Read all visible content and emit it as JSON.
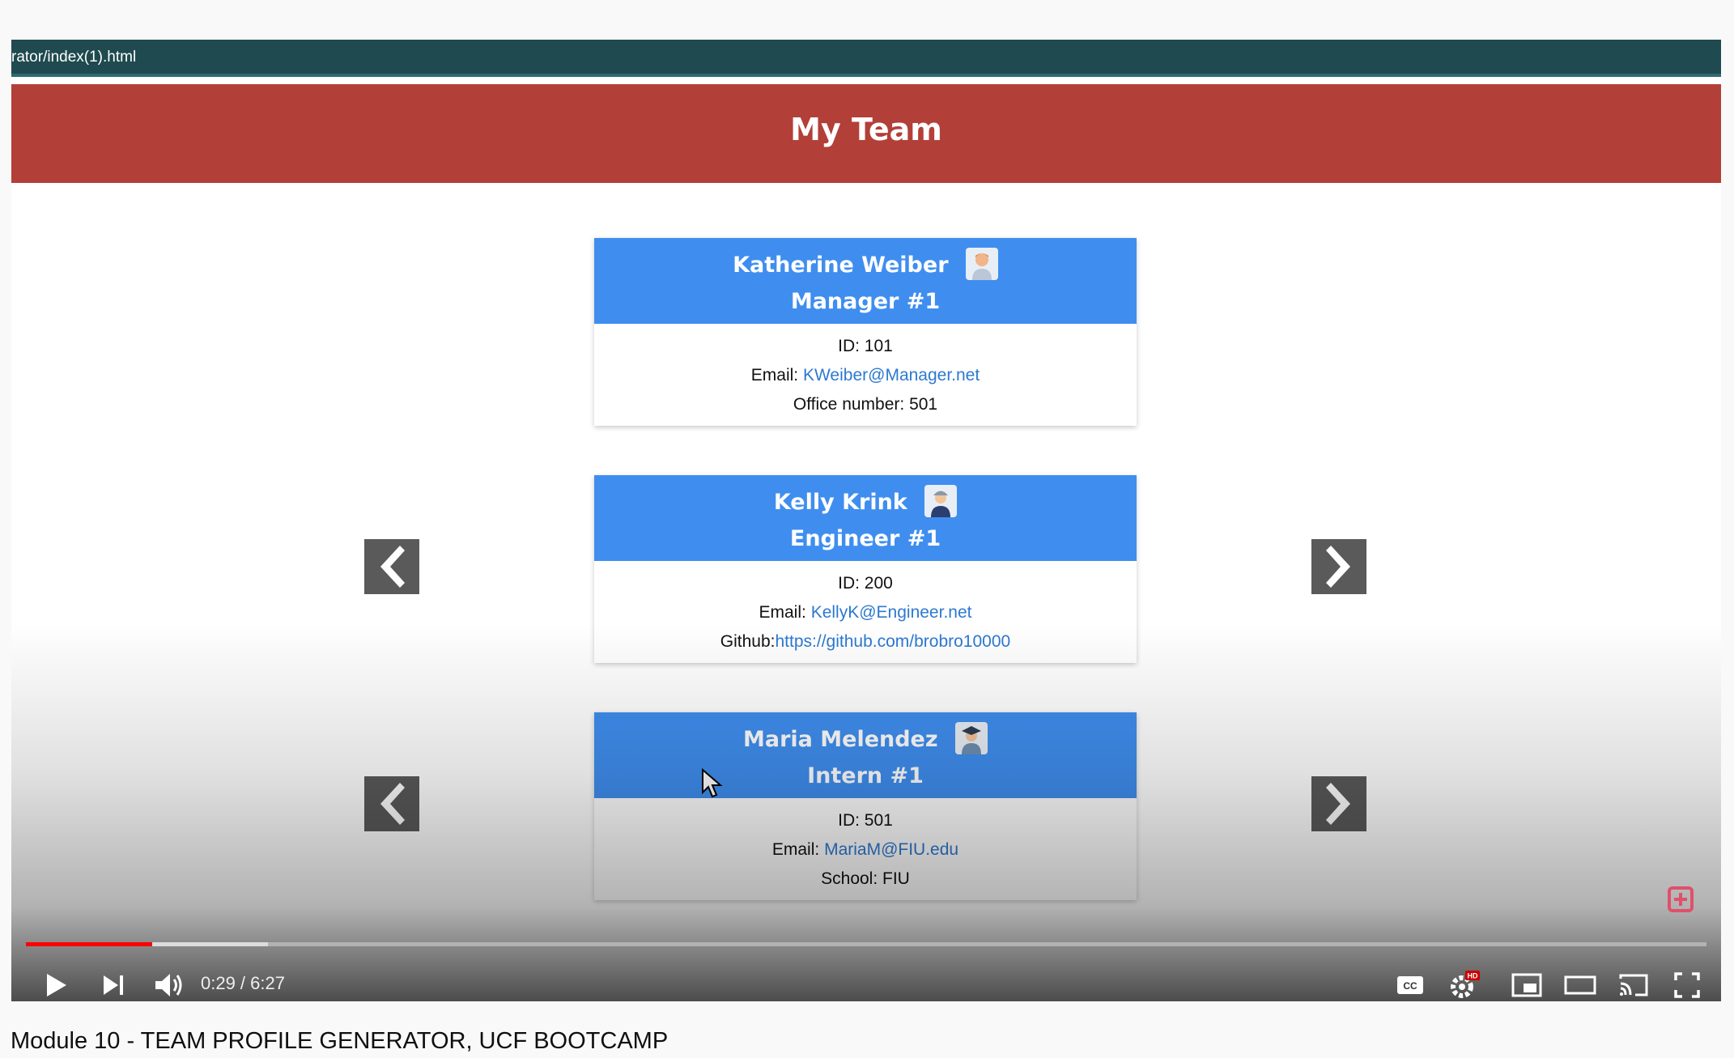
{
  "browser": {
    "url": "rator/index(1).html"
  },
  "page": {
    "heading": "My Team"
  },
  "team": [
    {
      "name": "Katherine Weiber",
      "role": "Manager #1",
      "id_line": "ID: 101",
      "email_label": "Email:",
      "email": "KWeiber@Manager.net",
      "extra_label": "Office number: 501",
      "extra_link": ""
    },
    {
      "name": "Kelly Krink",
      "role": "Engineer #1",
      "id_line": "ID: 200",
      "email_label": "Email:",
      "email": "KellyK@Engineer.net",
      "extra_label": "Github:",
      "extra_link": "https://github.com/brobro10000"
    },
    {
      "name": "Maria Melendez",
      "role": "Intern #1",
      "id_line": "ID: 501",
      "email_label": "Email:",
      "email": "MariaM@FIU.edu",
      "extra_label": "School: FIU",
      "extra_link": ""
    }
  ],
  "player": {
    "time": "0:29 / 6:27",
    "progress_played": 0.075,
    "progress_buffered": 0.144,
    "title": "Module 10 - TEAM PROFILE GENERATOR, UCF BOOTCAMP",
    "hd_badge": "HD"
  },
  "colors": {
    "banner": "#b33f39",
    "card_header": "#3f8eef",
    "urlbar": "#1f4a4f",
    "progress": "#ff0000"
  }
}
